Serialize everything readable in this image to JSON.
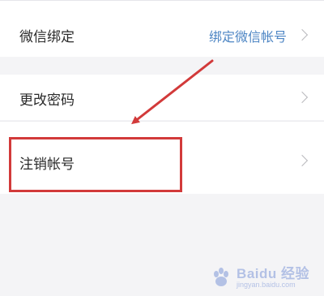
{
  "settings": {
    "wechat_bind": {
      "label": "微信绑定",
      "value": "绑定微信帐号"
    },
    "change_password": {
      "label": "更改密码"
    },
    "cancel_account": {
      "label": "注销帐号"
    }
  },
  "annotation": {
    "highlight_color": "#d23a3a",
    "arrow_color": "#d23a3a"
  },
  "watermark": {
    "line1": "Baidu 经验",
    "line2": "jingyan.baidu.com"
  },
  "colors": {
    "background": "#f4f4f6",
    "row_background": "#ffffff",
    "label_text": "#2a2a2a",
    "link_text": "#4e86c4",
    "chevron": "#b8b8bc"
  }
}
